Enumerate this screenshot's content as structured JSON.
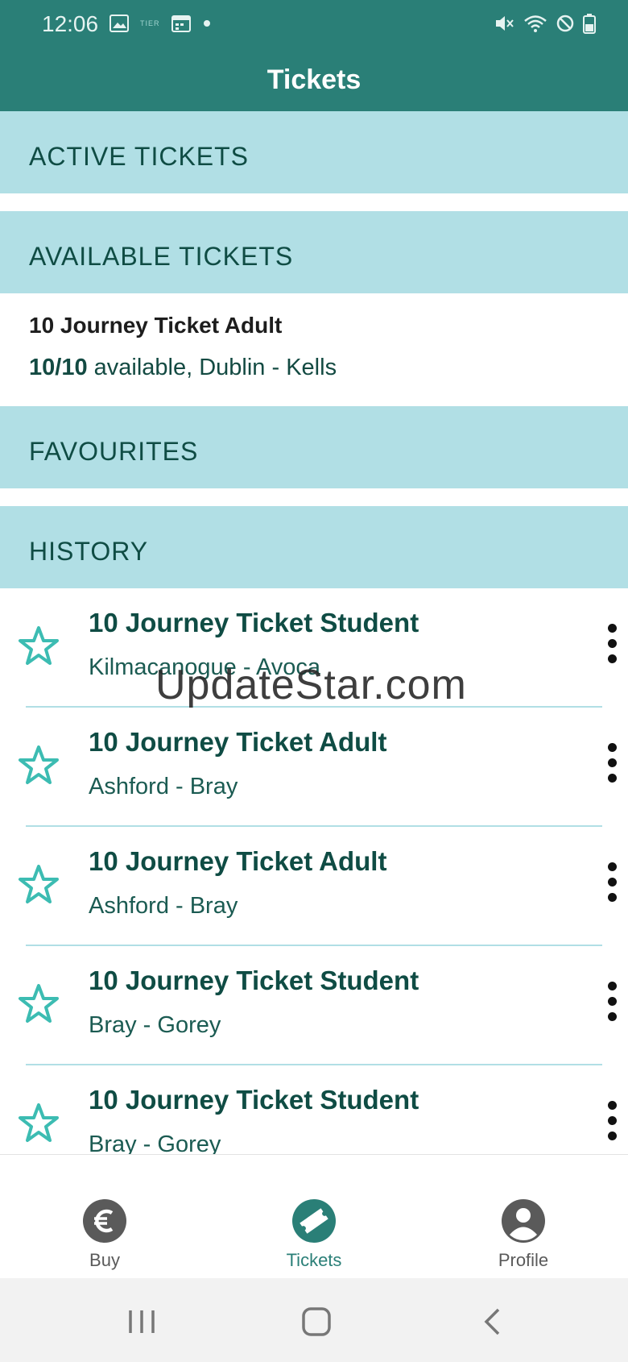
{
  "status_bar": {
    "time": "12:06",
    "tiny_label": "TIER",
    "icons": [
      "image-icon",
      "calendar-icon",
      "dot-icon",
      "mute-icon",
      "wifi-icon",
      "dnd-icon",
      "battery-icon"
    ]
  },
  "app_bar": {
    "title": "Tickets"
  },
  "sections": {
    "active": "ACTIVE TICKETS",
    "available": "AVAILABLE TICKETS",
    "favourites": "FAVOURITES",
    "history": "HISTORY"
  },
  "available_ticket": {
    "name": "10 Journey Ticket Adult",
    "count": "10/10",
    "details": " available, Dublin - Kells"
  },
  "history": [
    {
      "name": "10 Journey Ticket Student",
      "route": "Kilmacanogue - Avoca"
    },
    {
      "name": "10 Journey Ticket Adult",
      "route": "Ashford - Bray"
    },
    {
      "name": "10 Journey Ticket Adult",
      "route": "Ashford - Bray"
    },
    {
      "name": "10 Journey Ticket Student",
      "route": "Bray - Gorey"
    },
    {
      "name": "10 Journey Ticket Student",
      "route": "Bray - Gorey"
    }
  ],
  "watermark": "UpdateStar.com",
  "bottom_nav": {
    "buy": "Buy",
    "tickets": "Tickets",
    "profile": "Profile",
    "active": "tickets"
  },
  "colors": {
    "primary": "#2a7f77",
    "section_bg": "#b1dfe5",
    "text_dark": "#0f4c44",
    "star": "#3cbcb2"
  }
}
